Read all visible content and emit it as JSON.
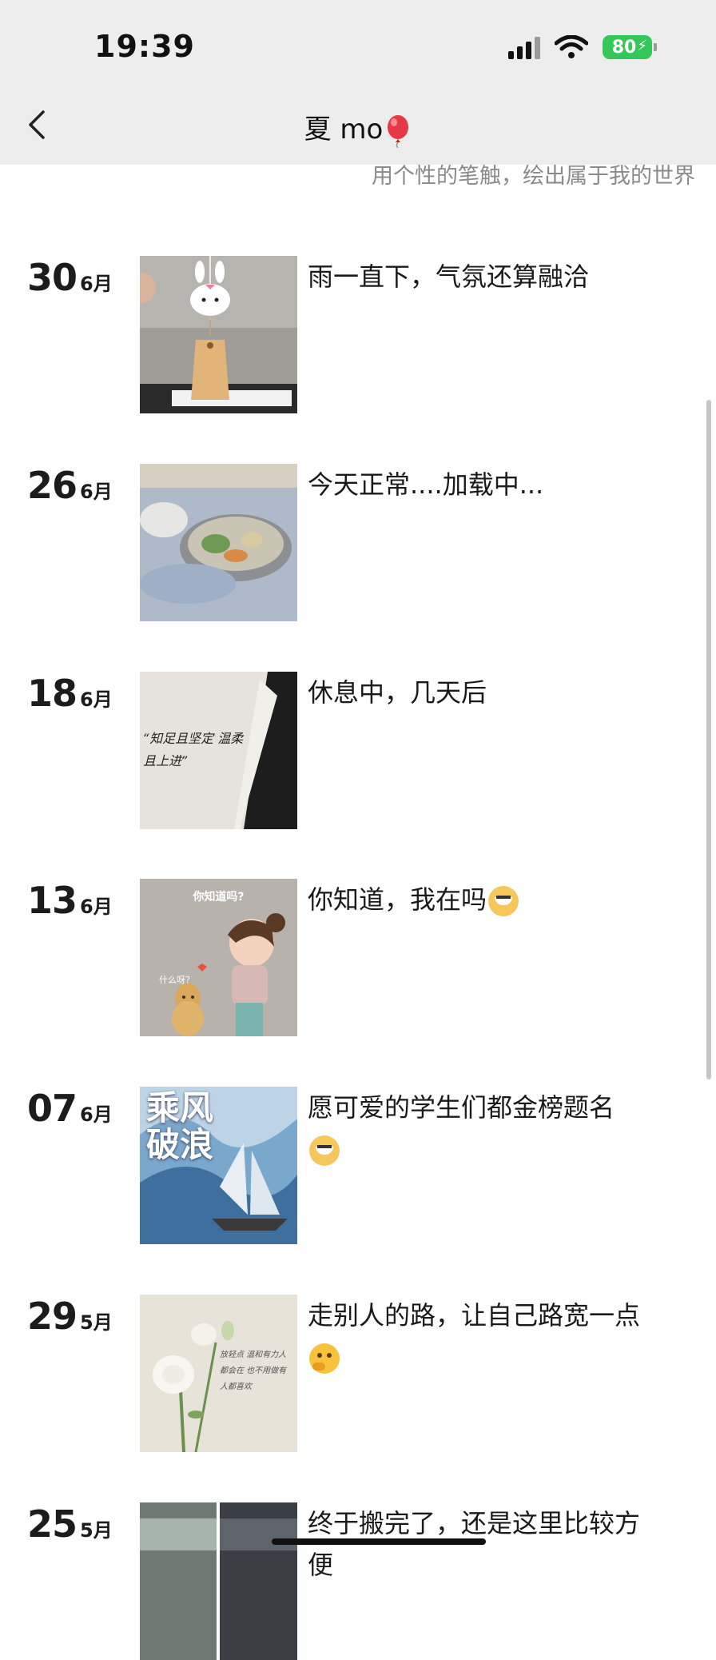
{
  "status_bar": {
    "time": "19:39",
    "battery": "80"
  },
  "nav": {
    "title": "夏 mo",
    "back_icon": "chevron-left-icon"
  },
  "signature": "用个性的笔触，绘出属于我的世界",
  "posts": [
    {
      "day": "30",
      "month": "6月",
      "caption": "雨一直下，气氛还算融洽",
      "image": "bunny-charm-photo"
    },
    {
      "day": "26",
      "month": "6月",
      "caption": "今天正常....加载中...",
      "image": "food-tray-photo"
    },
    {
      "day": "18",
      "month": "6月",
      "caption": "休息中，几天后",
      "image": "handwriting-photo"
    },
    {
      "day": "13",
      "month": "6月",
      "caption": "你知道，我在吗",
      "image": "girl-leopard-illustration"
    },
    {
      "day": "07",
      "month": "6月",
      "caption": "愿可爱的学生们都金榜题名",
      "image": "ship-poster"
    },
    {
      "day": "29",
      "month": "5月",
      "caption": "走别人的路，让自己路宽一点",
      "image": "flower-photo"
    },
    {
      "day": "25",
      "month": "5月",
      "caption": "终于搬完了，还是这里比较方便",
      "image": "street-photos"
    }
  ],
  "thumb_texts": {
    "handwriting": "“知足且坚定 温柔且上进”",
    "girl_top": "你知道吗?",
    "girl_small": "什么呀？",
    "poster_big": "乘风破浪",
    "flower_note": "放轻点 温和有力人都会在 也不用做有人都喜欢"
  },
  "colors": {
    "accent_green": "#34c759",
    "muted_text": "#8a8a8a"
  }
}
